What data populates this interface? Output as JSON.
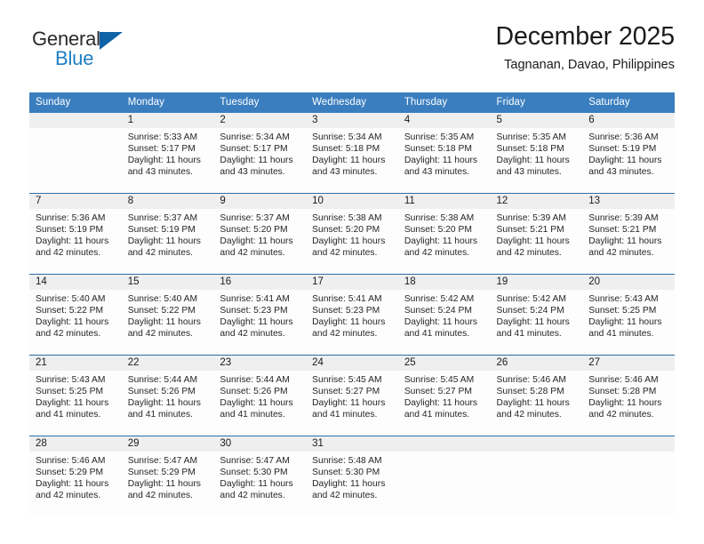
{
  "brand": {
    "line1": "General",
    "line2": "Blue",
    "logo_icon": "blue-triangle-icon",
    "accent_color": "#1163a8"
  },
  "header": {
    "title": "December 2025",
    "subtitle": "Tagnanan, Davao, Philippines"
  },
  "theme": {
    "header_row_background": "#3a7ebf",
    "row_divider": "#2e6da4",
    "daynum_background": "#efefef",
    "cell_background": "#fdfdfd"
  },
  "weekday_headers": [
    "Sunday",
    "Monday",
    "Tuesday",
    "Wednesday",
    "Thursday",
    "Friday",
    "Saturday"
  ],
  "weeks": [
    [
      {
        "day": "",
        "empty": true,
        "sunrise": "",
        "sunset": "",
        "daylight_line1": "",
        "daylight_line2": ""
      },
      {
        "day": "1",
        "sunrise": "Sunrise: 5:33 AM",
        "sunset": "Sunset: 5:17 PM",
        "daylight_line1": "Daylight: 11 hours",
        "daylight_line2": "and 43 minutes."
      },
      {
        "day": "2",
        "sunrise": "Sunrise: 5:34 AM",
        "sunset": "Sunset: 5:17 PM",
        "daylight_line1": "Daylight: 11 hours",
        "daylight_line2": "and 43 minutes."
      },
      {
        "day": "3",
        "sunrise": "Sunrise: 5:34 AM",
        "sunset": "Sunset: 5:18 PM",
        "daylight_line1": "Daylight: 11 hours",
        "daylight_line2": "and 43 minutes."
      },
      {
        "day": "4",
        "sunrise": "Sunrise: 5:35 AM",
        "sunset": "Sunset: 5:18 PM",
        "daylight_line1": "Daylight: 11 hours",
        "daylight_line2": "and 43 minutes."
      },
      {
        "day": "5",
        "sunrise": "Sunrise: 5:35 AM",
        "sunset": "Sunset: 5:18 PM",
        "daylight_line1": "Daylight: 11 hours",
        "daylight_line2": "and 43 minutes."
      },
      {
        "day": "6",
        "sunrise": "Sunrise: 5:36 AM",
        "sunset": "Sunset: 5:19 PM",
        "daylight_line1": "Daylight: 11 hours",
        "daylight_line2": "and 43 minutes."
      }
    ],
    [
      {
        "day": "7",
        "sunrise": "Sunrise: 5:36 AM",
        "sunset": "Sunset: 5:19 PM",
        "daylight_line1": "Daylight: 11 hours",
        "daylight_line2": "and 42 minutes."
      },
      {
        "day": "8",
        "sunrise": "Sunrise: 5:37 AM",
        "sunset": "Sunset: 5:19 PM",
        "daylight_line1": "Daylight: 11 hours",
        "daylight_line2": "and 42 minutes."
      },
      {
        "day": "9",
        "sunrise": "Sunrise: 5:37 AM",
        "sunset": "Sunset: 5:20 PM",
        "daylight_line1": "Daylight: 11 hours",
        "daylight_line2": "and 42 minutes."
      },
      {
        "day": "10",
        "sunrise": "Sunrise: 5:38 AM",
        "sunset": "Sunset: 5:20 PM",
        "daylight_line1": "Daylight: 11 hours",
        "daylight_line2": "and 42 minutes."
      },
      {
        "day": "11",
        "sunrise": "Sunrise: 5:38 AM",
        "sunset": "Sunset: 5:20 PM",
        "daylight_line1": "Daylight: 11 hours",
        "daylight_line2": "and 42 minutes."
      },
      {
        "day": "12",
        "sunrise": "Sunrise: 5:39 AM",
        "sunset": "Sunset: 5:21 PM",
        "daylight_line1": "Daylight: 11 hours",
        "daylight_line2": "and 42 minutes."
      },
      {
        "day": "13",
        "sunrise": "Sunrise: 5:39 AM",
        "sunset": "Sunset: 5:21 PM",
        "daylight_line1": "Daylight: 11 hours",
        "daylight_line2": "and 42 minutes."
      }
    ],
    [
      {
        "day": "14",
        "sunrise": "Sunrise: 5:40 AM",
        "sunset": "Sunset: 5:22 PM",
        "daylight_line1": "Daylight: 11 hours",
        "daylight_line2": "and 42 minutes."
      },
      {
        "day": "15",
        "sunrise": "Sunrise: 5:40 AM",
        "sunset": "Sunset: 5:22 PM",
        "daylight_line1": "Daylight: 11 hours",
        "daylight_line2": "and 42 minutes."
      },
      {
        "day": "16",
        "sunrise": "Sunrise: 5:41 AM",
        "sunset": "Sunset: 5:23 PM",
        "daylight_line1": "Daylight: 11 hours",
        "daylight_line2": "and 42 minutes."
      },
      {
        "day": "17",
        "sunrise": "Sunrise: 5:41 AM",
        "sunset": "Sunset: 5:23 PM",
        "daylight_line1": "Daylight: 11 hours",
        "daylight_line2": "and 42 minutes."
      },
      {
        "day": "18",
        "sunrise": "Sunrise: 5:42 AM",
        "sunset": "Sunset: 5:24 PM",
        "daylight_line1": "Daylight: 11 hours",
        "daylight_line2": "and 41 minutes."
      },
      {
        "day": "19",
        "sunrise": "Sunrise: 5:42 AM",
        "sunset": "Sunset: 5:24 PM",
        "daylight_line1": "Daylight: 11 hours",
        "daylight_line2": "and 41 minutes."
      },
      {
        "day": "20",
        "sunrise": "Sunrise: 5:43 AM",
        "sunset": "Sunset: 5:25 PM",
        "daylight_line1": "Daylight: 11 hours",
        "daylight_line2": "and 41 minutes."
      }
    ],
    [
      {
        "day": "21",
        "sunrise": "Sunrise: 5:43 AM",
        "sunset": "Sunset: 5:25 PM",
        "daylight_line1": "Daylight: 11 hours",
        "daylight_line2": "and 41 minutes."
      },
      {
        "day": "22",
        "sunrise": "Sunrise: 5:44 AM",
        "sunset": "Sunset: 5:26 PM",
        "daylight_line1": "Daylight: 11 hours",
        "daylight_line2": "and 41 minutes."
      },
      {
        "day": "23",
        "sunrise": "Sunrise: 5:44 AM",
        "sunset": "Sunset: 5:26 PM",
        "daylight_line1": "Daylight: 11 hours",
        "daylight_line2": "and 41 minutes."
      },
      {
        "day": "24",
        "sunrise": "Sunrise: 5:45 AM",
        "sunset": "Sunset: 5:27 PM",
        "daylight_line1": "Daylight: 11 hours",
        "daylight_line2": "and 41 minutes."
      },
      {
        "day": "25",
        "sunrise": "Sunrise: 5:45 AM",
        "sunset": "Sunset: 5:27 PM",
        "daylight_line1": "Daylight: 11 hours",
        "daylight_line2": "and 41 minutes."
      },
      {
        "day": "26",
        "sunrise": "Sunrise: 5:46 AM",
        "sunset": "Sunset: 5:28 PM",
        "daylight_line1": "Daylight: 11 hours",
        "daylight_line2": "and 42 minutes."
      },
      {
        "day": "27",
        "sunrise": "Sunrise: 5:46 AM",
        "sunset": "Sunset: 5:28 PM",
        "daylight_line1": "Daylight: 11 hours",
        "daylight_line2": "and 42 minutes."
      }
    ],
    [
      {
        "day": "28",
        "sunrise": "Sunrise: 5:46 AM",
        "sunset": "Sunset: 5:29 PM",
        "daylight_line1": "Daylight: 11 hours",
        "daylight_line2": "and 42 minutes."
      },
      {
        "day": "29",
        "sunrise": "Sunrise: 5:47 AM",
        "sunset": "Sunset: 5:29 PM",
        "daylight_line1": "Daylight: 11 hours",
        "daylight_line2": "and 42 minutes."
      },
      {
        "day": "30",
        "sunrise": "Sunrise: 5:47 AM",
        "sunset": "Sunset: 5:30 PM",
        "daylight_line1": "Daylight: 11 hours",
        "daylight_line2": "and 42 minutes."
      },
      {
        "day": "31",
        "sunrise": "Sunrise: 5:48 AM",
        "sunset": "Sunset: 5:30 PM",
        "daylight_line1": "Daylight: 11 hours",
        "daylight_line2": "and 42 minutes."
      },
      {
        "day": "",
        "empty": true,
        "sunrise": "",
        "sunset": "",
        "daylight_line1": "",
        "daylight_line2": ""
      },
      {
        "day": "",
        "empty": true,
        "sunrise": "",
        "sunset": "",
        "daylight_line1": "",
        "daylight_line2": ""
      },
      {
        "day": "",
        "empty": true,
        "sunrise": "",
        "sunset": "",
        "daylight_line1": "",
        "daylight_line2": ""
      }
    ]
  ]
}
